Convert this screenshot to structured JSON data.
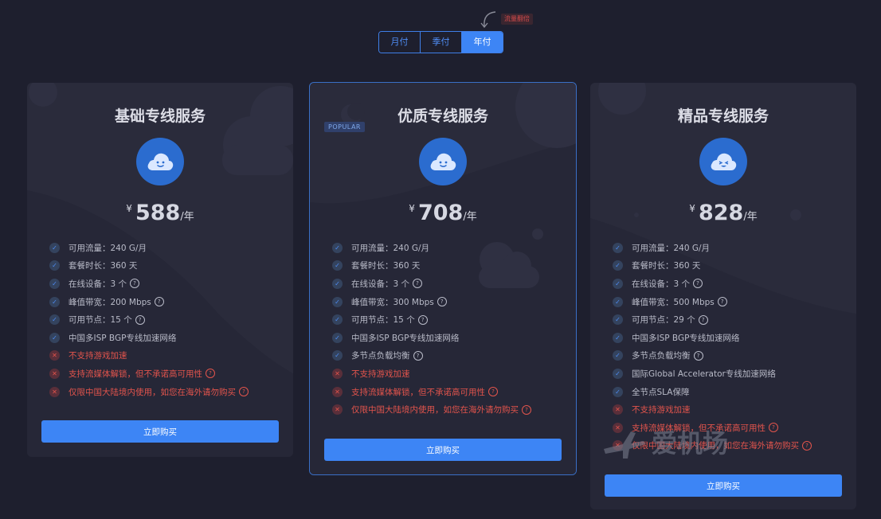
{
  "billing": {
    "options": [
      "月付",
      "季付",
      "年付"
    ],
    "active": "年付",
    "promo": "流量翻倍"
  },
  "plans": [
    {
      "title": "基础专线服务",
      "currency": "¥",
      "price": "588",
      "unit": "/年",
      "features": [
        {
          "text": "可用流量：240 G/月",
          "ok": true,
          "help": false
        },
        {
          "text": "套餐时长：360 天",
          "ok": true,
          "help": false
        },
        {
          "text": "在线设备：3 个",
          "ok": true,
          "help": true
        },
        {
          "text": "峰值带宽：200 Mbps",
          "ok": true,
          "help": true
        },
        {
          "text": "可用节点：15 个",
          "ok": true,
          "help": true
        },
        {
          "text": "中国多ISP BGP专线加速网络",
          "ok": true,
          "help": false
        },
        {
          "text": "不支持游戏加速",
          "ok": false,
          "help": false
        },
        {
          "text": "支持流媒体解锁，但不承诺高可用性",
          "ok": false,
          "help": true
        },
        {
          "text": "仅限中国大陆境内使用，如您在海外请勿购买",
          "ok": false,
          "help": true
        }
      ],
      "button": "立即购买"
    },
    {
      "badge": "POPULAR",
      "title": "优质专线服务",
      "currency": "¥",
      "price": "708",
      "unit": "/年",
      "features": [
        {
          "text": "可用流量：240 G/月",
          "ok": true,
          "help": false
        },
        {
          "text": "套餐时长：360 天",
          "ok": true,
          "help": false
        },
        {
          "text": "在线设备：3 个",
          "ok": true,
          "help": true
        },
        {
          "text": "峰值带宽：300 Mbps",
          "ok": true,
          "help": true
        },
        {
          "text": "可用节点：15 个",
          "ok": true,
          "help": true
        },
        {
          "text": "中国多ISP BGP专线加速网络",
          "ok": true,
          "help": false
        },
        {
          "text": "多节点负载均衡",
          "ok": true,
          "help": true
        },
        {
          "text": "不支持游戏加速",
          "ok": false,
          "help": false
        },
        {
          "text": "支持流媒体解锁，但不承诺高可用性",
          "ok": false,
          "help": true
        },
        {
          "text": "仅限中国大陆境内使用，如您在海外请勿购买",
          "ok": false,
          "help": true
        }
      ],
      "button": "立即购买"
    },
    {
      "title": "精品专线服务",
      "currency": "¥",
      "price": "828",
      "unit": "/年",
      "features": [
        {
          "text": "可用流量：240 G/月",
          "ok": true,
          "help": false
        },
        {
          "text": "套餐时长：360 天",
          "ok": true,
          "help": false
        },
        {
          "text": "在线设备：3 个",
          "ok": true,
          "help": true
        },
        {
          "text": "峰值带宽：500 Mbps",
          "ok": true,
          "help": true
        },
        {
          "text": "可用节点：29 个",
          "ok": true,
          "help": true
        },
        {
          "text": "中国多ISP BGP专线加速网络",
          "ok": true,
          "help": false
        },
        {
          "text": "多节点负载均衡",
          "ok": true,
          "help": true
        },
        {
          "text": "国际Global Accelerator专线加速网络",
          "ok": true,
          "help": false
        },
        {
          "text": "全节点SLA保障",
          "ok": true,
          "help": false
        },
        {
          "text": "不支持游戏加速",
          "ok": false,
          "help": false
        },
        {
          "text": "支持流媒体解锁，但不承诺高可用性",
          "ok": false,
          "help": true
        },
        {
          "text": "仅限中国大陆境内使用，如您在海外请勿购买",
          "ok": false,
          "help": true
        }
      ],
      "button": "立即购买"
    }
  ],
  "watermark": "爱机场",
  "colors": {
    "background": "#1e1f2e",
    "card": "#2a2b3b",
    "accent": "#3d85f5",
    "negative": "#e2544c"
  }
}
